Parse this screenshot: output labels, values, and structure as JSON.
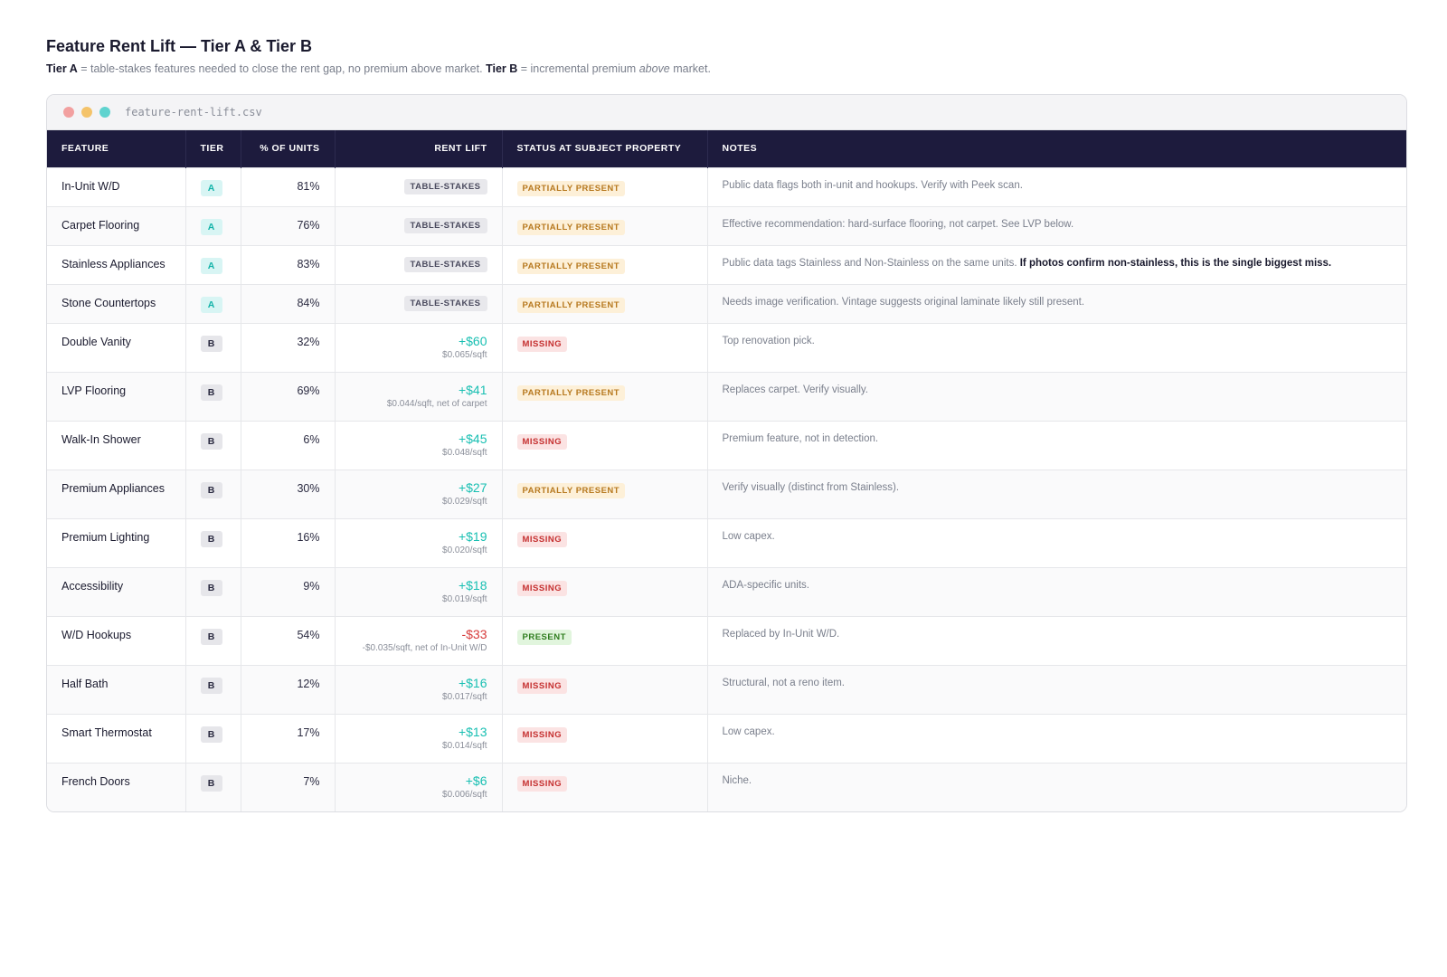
{
  "header": {
    "title": "Feature Rent Lift — Tier A & Tier B",
    "legend": {
      "tier_a_label": "Tier A",
      "tier_a_text": " = table-stakes features needed to close the rent gap, no premium above market. ",
      "tier_b_label": "Tier B",
      "tier_b_text_1": " = incremental premium ",
      "tier_b_emph": "above",
      "tier_b_text_2": " market."
    }
  },
  "window": {
    "file_name": "feature-rent-lift.csv",
    "dot_colors": [
      "#f2a0a0",
      "#f4c36a",
      "#5fd3cf"
    ]
  },
  "table": {
    "columns": [
      "Feature",
      "Tier",
      "% of Units",
      "Rent Lift",
      "Status at Subject Property",
      "Notes"
    ],
    "rows": [
      {
        "feature": "In-Unit W/D",
        "tier": "A",
        "pct": "81%",
        "lift": "TABLE-STAKES",
        "lift_type": "table-stakes",
        "lift_sub": "",
        "status": "PARTIALLY PRESENT",
        "status_type": "partial",
        "note": "Public data flags both in-unit and hookups. Verify with Peek scan.",
        "note_bold": ""
      },
      {
        "feature": "Carpet Flooring",
        "tier": "A",
        "pct": "76%",
        "lift": "TABLE-STAKES",
        "lift_type": "table-stakes",
        "lift_sub": "",
        "status": "PARTIALLY PRESENT",
        "status_type": "partial",
        "note": "Effective recommendation: hard-surface flooring, not carpet. See LVP below.",
        "note_bold": ""
      },
      {
        "feature": "Stainless Appliances",
        "tier": "A",
        "pct": "83%",
        "lift": "TABLE-STAKES",
        "lift_type": "table-stakes",
        "lift_sub": "",
        "status": "PARTIALLY PRESENT",
        "status_type": "partial",
        "note": "Public data tags Stainless and Non-Stainless on the same units. ",
        "note_bold": "If photos confirm non-stainless, this is the single biggest miss."
      },
      {
        "feature": "Stone Countertops",
        "tier": "A",
        "pct": "84%",
        "lift": "TABLE-STAKES",
        "lift_type": "table-stakes",
        "lift_sub": "",
        "status": "PARTIALLY PRESENT",
        "status_type": "partial",
        "note": "Needs image verification. Vintage suggests original laminate likely still present.",
        "note_bold": ""
      },
      {
        "feature": "Double Vanity",
        "tier": "B",
        "pct": "32%",
        "lift": "+$60",
        "lift_type": "positive",
        "lift_sub": "$0.065/sqft",
        "status": "MISSING",
        "status_type": "missing",
        "note": "Top renovation pick.",
        "note_bold": ""
      },
      {
        "feature": "LVP Flooring",
        "tier": "B",
        "pct": "69%",
        "lift": "+$41",
        "lift_type": "positive",
        "lift_sub": "$0.044/sqft, net of carpet",
        "status": "PARTIALLY PRESENT",
        "status_type": "partial",
        "note": "Replaces carpet. Verify visually.",
        "note_bold": ""
      },
      {
        "feature": "Walk-In Shower",
        "tier": "B",
        "pct": "6%",
        "lift": "+$45",
        "lift_type": "positive",
        "lift_sub": "$0.048/sqft",
        "status": "MISSING",
        "status_type": "missing",
        "note": "Premium feature, not in detection.",
        "note_bold": ""
      },
      {
        "feature": "Premium Appliances",
        "tier": "B",
        "pct": "30%",
        "lift": "+$27",
        "lift_type": "positive",
        "lift_sub": "$0.029/sqft",
        "status": "PARTIALLY PRESENT",
        "status_type": "partial",
        "note": "Verify visually (distinct from Stainless).",
        "note_bold": ""
      },
      {
        "feature": "Premium Lighting",
        "tier": "B",
        "pct": "16%",
        "lift": "+$19",
        "lift_type": "positive",
        "lift_sub": "$0.020/sqft",
        "status": "MISSING",
        "status_type": "missing",
        "note": "Low capex.",
        "note_bold": ""
      },
      {
        "feature": "Accessibility",
        "tier": "B",
        "pct": "9%",
        "lift": "+$18",
        "lift_type": "positive",
        "lift_sub": "$0.019/sqft",
        "status": "MISSING",
        "status_type": "missing",
        "note": "ADA-specific units.",
        "note_bold": ""
      },
      {
        "feature": "W/D Hookups",
        "tier": "B",
        "pct": "54%",
        "lift": "-$33",
        "lift_type": "negative",
        "lift_sub": "-$0.035/sqft, net of In-Unit W/D",
        "status": "PRESENT",
        "status_type": "present",
        "note": "Replaced by In-Unit W/D.",
        "note_bold": ""
      },
      {
        "feature": "Half Bath",
        "tier": "B",
        "pct": "12%",
        "lift": "+$16",
        "lift_type": "positive",
        "lift_sub": "$0.017/sqft",
        "status": "MISSING",
        "status_type": "missing",
        "note": "Structural, not a reno item.",
        "note_bold": ""
      },
      {
        "feature": "Smart Thermostat",
        "tier": "B",
        "pct": "17%",
        "lift": "+$13",
        "lift_type": "positive",
        "lift_sub": "$0.014/sqft",
        "status": "MISSING",
        "status_type": "missing",
        "note": "Low capex.",
        "note_bold": ""
      },
      {
        "feature": "French Doors",
        "tier": "B",
        "pct": "7%",
        "lift": "+$6",
        "lift_type": "positive",
        "lift_sub": "$0.006/sqft",
        "status": "MISSING",
        "status_type": "missing",
        "note": "Niche.",
        "note_bold": ""
      }
    ]
  },
  "colors": {
    "header_bg": "#1d1b3d",
    "lift_positive": "#18bfb2",
    "lift_negative": "#d63b3b",
    "status_partial": "#b7791f",
    "status_missing": "#c53030",
    "status_present": "#2f7d1f"
  }
}
